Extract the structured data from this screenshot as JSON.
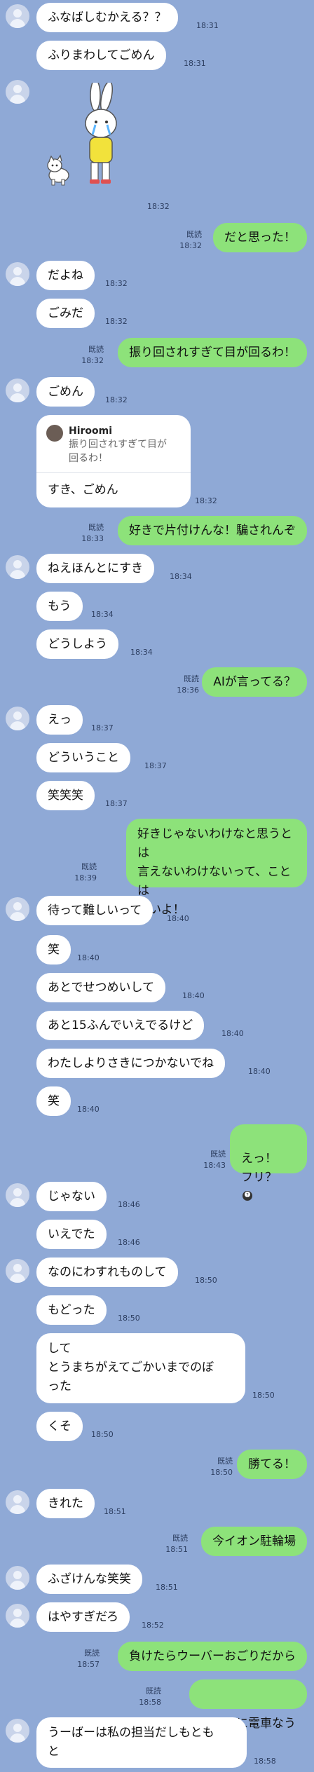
{
  "messages": [
    {
      "side": "in",
      "text": "ふなばしむかえる？？",
      "time": "18:31"
    },
    {
      "side": "in",
      "text": "ふりまわしてごめん",
      "time": "18:31"
    },
    {
      "side": "in",
      "sticker": "crying-rabbit-sticker",
      "time": "18:32"
    },
    {
      "side": "out",
      "read": "既読",
      "time": "18:32",
      "text": "だと思った！"
    },
    {
      "side": "in",
      "text": "だよね",
      "time": "18:32"
    },
    {
      "side": "in",
      "text": "ごみだ",
      "time": "18:32"
    },
    {
      "side": "out",
      "read": "既読",
      "time": "18:32",
      "text": "振り回されすぎて目が回るわ！"
    },
    {
      "side": "in",
      "text": "ごめん",
      "time": "18:32"
    },
    {
      "side": "in",
      "quote": {
        "name": "Hiroomi",
        "text": "振り回されすぎて目が\n回るわ！"
      },
      "text": "すき、ごめん",
      "time": "18:32"
    },
    {
      "side": "out",
      "read": "既読",
      "time": "18:33",
      "text": "好きで片付けんな！騙されんぞ"
    },
    {
      "side": "in",
      "text": "ねえほんとにすき",
      "time": "18:34"
    },
    {
      "side": "in",
      "text": "もう",
      "time": "18:34"
    },
    {
      "side": "in",
      "text": "どうしよう",
      "time": "18:34"
    },
    {
      "side": "out",
      "read": "既読",
      "time": "18:36",
      "text": "AIが言ってる？"
    },
    {
      "side": "in",
      "text": "えっ",
      "time": "18:37"
    },
    {
      "side": "in",
      "text": "どういうこと",
      "time": "18:37"
    },
    {
      "side": "in",
      "text": "笑笑笑",
      "time": "18:37"
    },
    {
      "side": "out",
      "read": "既読",
      "time": "18:39",
      "text": "好きじゃないわけなと思うとは\n言えないわけないって、ことは\n無いよ！"
    },
    {
      "side": "in",
      "text": "待って難しいって",
      "time": "18:40"
    },
    {
      "side": "in",
      "text": "笑",
      "time": "18:40"
    },
    {
      "side": "in",
      "text": "あとでせつめいして",
      "time": "18:40"
    },
    {
      "side": "in",
      "text": "あと15ふんでいえでるけど",
      "time": "18:40"
    },
    {
      "side": "in",
      "text": "わたしよりさきにつかないでね",
      "time": "18:40"
    },
    {
      "side": "in",
      "text": "笑",
      "time": "18:40"
    },
    {
      "side": "out",
      "read": "既読",
      "time": "18:43",
      "text": "えっ！\nフリ？"
    },
    {
      "side": "in",
      "text": "じゃない",
      "time": "18:46"
    },
    {
      "side": "in",
      "text": "いえでた",
      "time": "18:46"
    },
    {
      "side": "in",
      "text": "なのにわすれものして",
      "time": "18:50"
    },
    {
      "side": "in",
      "text": "もどった",
      "time": "18:50"
    },
    {
      "side": "in",
      "text": "して\nとうまちがえてごかいまでのぼ\nった",
      "time": "18:50"
    },
    {
      "side": "in",
      "text": "くそ",
      "time": "18:50"
    },
    {
      "side": "out",
      "read": "既読",
      "time": "18:50",
      "text": "勝てる！"
    },
    {
      "side": "in",
      "text": "きれた",
      "time": "18:51"
    },
    {
      "side": "out",
      "read": "既読",
      "time": "18:51",
      "text": "今イオン駐輪場"
    },
    {
      "side": "in",
      "text": "ふざけんな笑笑",
      "time": "18:51"
    },
    {
      "side": "in",
      "text": "はやすぎだろ",
      "time": "18:52"
    },
    {
      "side": "out",
      "read": "既読",
      "time": "18:57",
      "text": "負けたらウーバーおごりだから"
    },
    {
      "side": "out",
      "read": "既読",
      "time": "18:58",
      "text": "ちなみに電車なう"
    },
    {
      "side": "in",
      "text": "うーばーは私の担当だしもとも\nと",
      "time": "18:58"
    }
  ]
}
